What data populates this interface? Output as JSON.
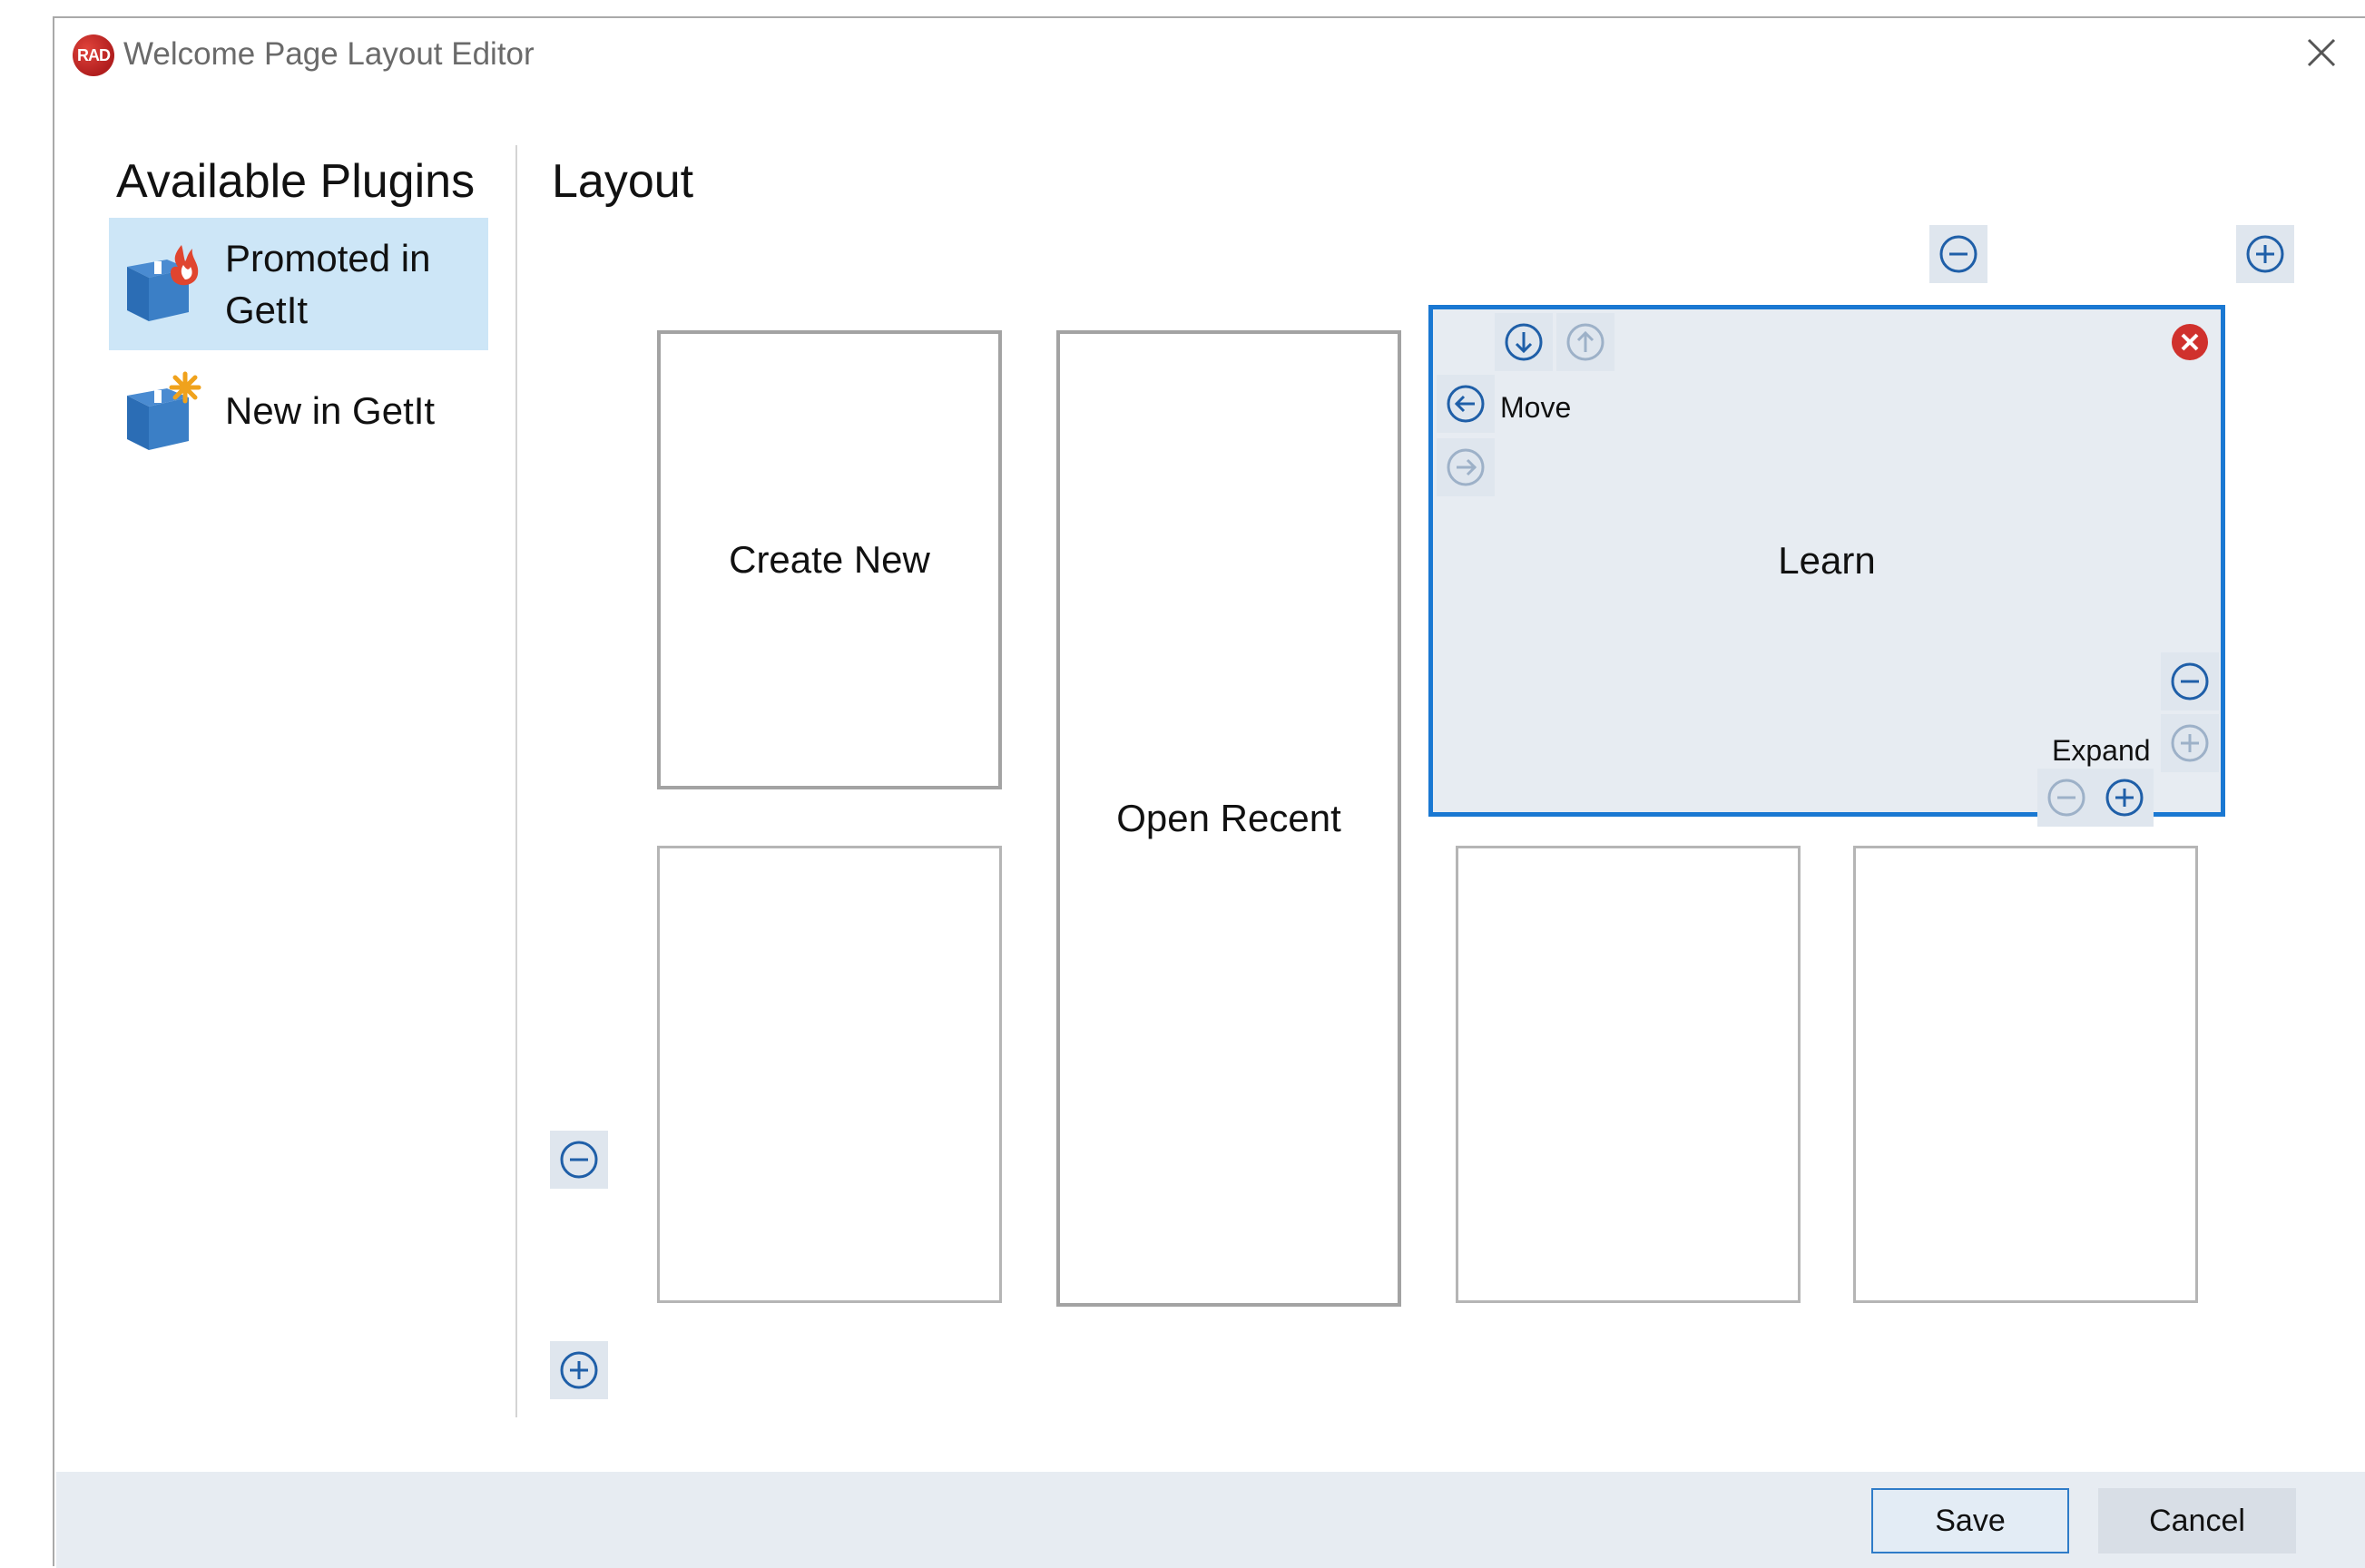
{
  "window": {
    "title": "Welcome Page Layout Editor",
    "logo_text": "RAD",
    "close_icon": "close-icon"
  },
  "sidebar": {
    "title": "Available Plugins",
    "items": [
      {
        "label": "Promoted in GetIt",
        "icon": "box-flame-icon",
        "selected": true
      },
      {
        "label": "New in GetIt",
        "icon": "box-star-icon",
        "selected": false
      }
    ]
  },
  "layout": {
    "title": "Layout",
    "tiles": [
      {
        "label": "Create New"
      },
      {
        "label": "Open Recent"
      },
      {
        "label": "Learn",
        "selected": true
      },
      {
        "label": ""
      },
      {
        "label": ""
      },
      {
        "label": ""
      }
    ],
    "learn_controls": {
      "move_label": "Move",
      "expand_label": "Expand"
    }
  },
  "footer": {
    "save_label": "Save",
    "cancel_label": "Cancel"
  },
  "colors": {
    "accent": "#1a78d2",
    "selected_plugin_bg": "#cde6f7",
    "button_bg": "#dfe6ee",
    "footer_bg": "#e7ecf2",
    "remove_red": "#d0312d",
    "icon_blue": "#1f5fa8"
  }
}
